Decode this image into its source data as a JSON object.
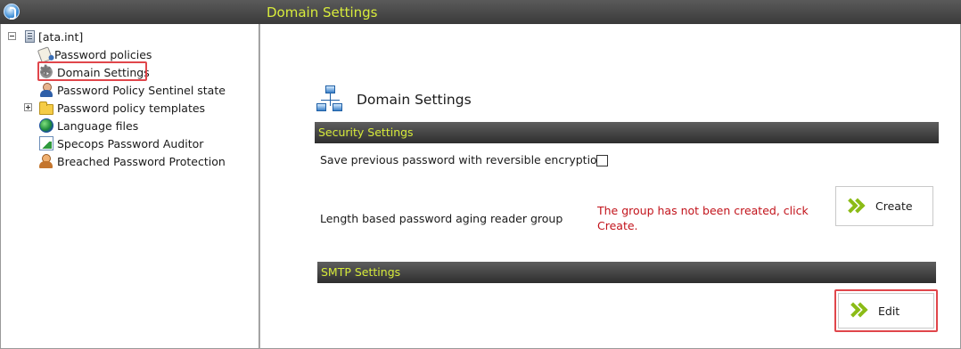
{
  "header": {
    "title": "Domain Settings"
  },
  "tree": {
    "root": "[ata.int]",
    "items": [
      "Password policies",
      "Domain Settings",
      "Password Policy Sentinel state",
      "Password policy templates",
      "Language files",
      "Specops Password Auditor",
      "Breached Password Protection"
    ]
  },
  "main": {
    "title": "Domain Settings",
    "security": {
      "heading": "Security Settings",
      "reversible_label": "Save previous password with reversible encryption",
      "reader_group_label": "Length based password aging reader group",
      "warning": "The group has not been created, click Create.",
      "create_label": "Create"
    },
    "smtp": {
      "heading": "SMTP Settings",
      "edit_label": "Edit"
    }
  },
  "colors": {
    "header_text": "#d8ec3c",
    "warning": "#c2131b",
    "highlight": "#e0464b",
    "chevron": "#8bbb16"
  }
}
